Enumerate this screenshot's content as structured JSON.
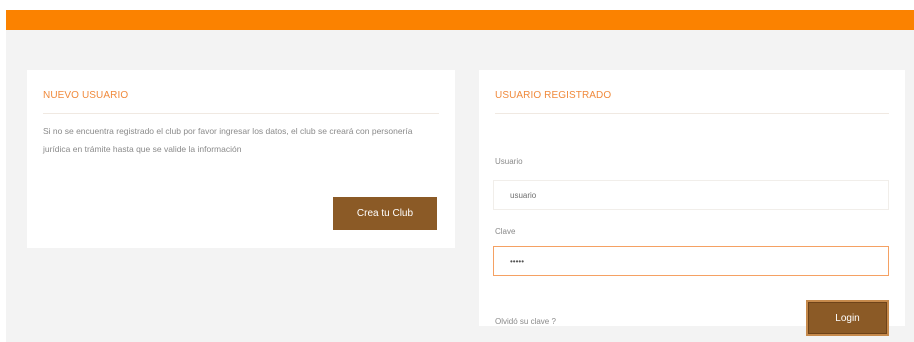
{
  "new_user": {
    "title": "NUEVO USUARIO",
    "description": "Si no se encuentra registrado el club por favor ingresar los datos, el club se creará con personería jurídica en trámite hasta que se valide la información",
    "create_button": "Crea tu Club"
  },
  "registered_user": {
    "title": "USUARIO REGISTRADO",
    "username_label": "Usuario",
    "username_value": "usuario",
    "password_label": "Clave",
    "password_value": "•••••",
    "forgot_link": "Olvidó su clave ?",
    "login_button": "Login"
  },
  "colors": {
    "accent_orange": "#fb8200",
    "button_brown": "#8b5a26",
    "title_orange": "#f08a3c"
  }
}
